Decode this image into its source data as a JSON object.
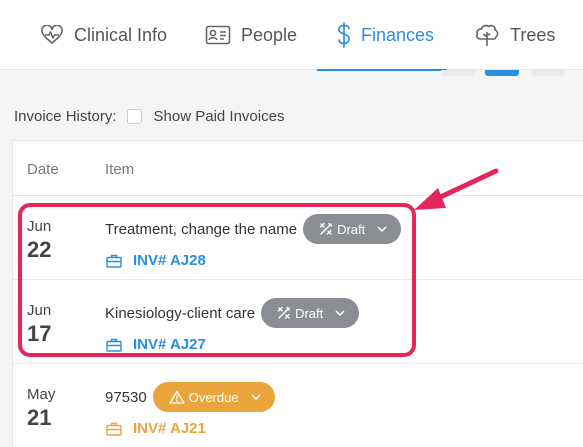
{
  "tabs": [
    {
      "label": "Clinical Info",
      "icon": "heart-pulse-icon"
    },
    {
      "label": "People",
      "icon": "id-card-icon"
    },
    {
      "label": "Finances",
      "icon": "dollar-icon"
    },
    {
      "label": "Trees",
      "icon": "tree-icon"
    }
  ],
  "filter": {
    "label": "Invoice History:",
    "checkbox_label": "Show Paid Invoices"
  },
  "table": {
    "headers": {
      "date": "Date",
      "item": "Item"
    },
    "rows": [
      {
        "month": "Jun",
        "day": "22",
        "description": "Treatment, change the name",
        "status": "Draft",
        "invoice": "INV# AJ28"
      },
      {
        "month": "Jun",
        "day": "17",
        "description": "Kinesiology-client care",
        "status": "Draft",
        "invoice": "INV# AJ27"
      },
      {
        "month": "May",
        "day": "21",
        "description": "97530",
        "status": "Overdue",
        "invoice": "INV# AJ21"
      }
    ]
  },
  "colors": {
    "accent": "#2b8fe0",
    "draft": "#8a8d91",
    "overdue": "#eaa53c",
    "annotation": "#e5265a"
  }
}
